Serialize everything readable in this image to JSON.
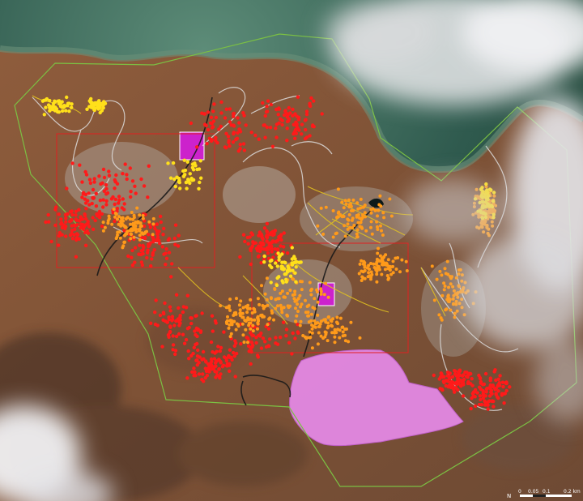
{
  "basemap": {
    "type": "satellite",
    "colors": {
      "land": "#8a5a3a",
      "land_dark": "#5a3a28",
      "sea": "#2f5a4e",
      "sea_shallow": "#4f7f6a",
      "cloud": "#e8e8ea",
      "urban": "#a89a90"
    }
  },
  "overlay_colors": {
    "boundary": "#7bc043",
    "extent_box": "#e02020",
    "roads": "#e0c020",
    "paths": "#dddddd",
    "river": "#1a1a1a",
    "affected_area": "#e68ae8",
    "facility": "#cc22cc"
  },
  "damage_classes": [
    {
      "id": "destroyed",
      "color": "#ff1a1a"
    },
    {
      "id": "damaged",
      "color": "#ff9a1a"
    },
    {
      "id": "possibly_damaged",
      "color": "#ffe01a"
    }
  ],
  "scale_bar": {
    "north_label": "N",
    "labels": [
      "0",
      "0.05",
      "0.1",
      "0.2 km"
    ]
  }
}
